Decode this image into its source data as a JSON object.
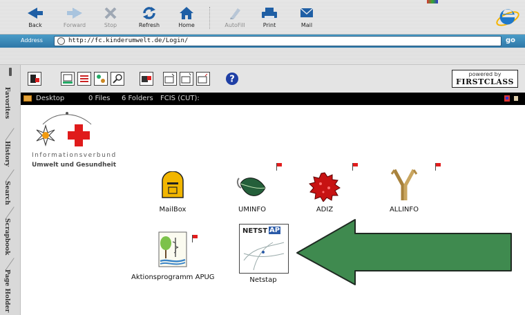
{
  "browser": {
    "toolbar": [
      {
        "label": "Back",
        "icon": "back-arrow-icon",
        "enabled": true
      },
      {
        "label": "Forward",
        "icon": "forward-arrow-icon",
        "enabled": false
      },
      {
        "label": "Stop",
        "icon": "stop-icon",
        "enabled": false
      },
      {
        "label": "Refresh",
        "icon": "refresh-icon",
        "enabled": true
      },
      {
        "label": "Home",
        "icon": "home-icon",
        "enabled": true
      },
      {
        "label": "AutoFill",
        "icon": "autofill-icon",
        "enabled": false
      },
      {
        "label": "Print",
        "icon": "print-icon",
        "enabled": true
      },
      {
        "label": "Mail",
        "icon": "mail-icon",
        "enabled": true
      }
    ],
    "address_label": "Address",
    "address_url": "http://fc.kinderumwelt.de/Login/",
    "go_label": "go"
  },
  "sidebar_tabs": [
    "Favorites",
    "History",
    "Search",
    "Scrapbook",
    "Page Holder"
  ],
  "firstclass": {
    "powered_by_small": "powered by",
    "powered_by_brand": "FIRSTCLASS",
    "desktop_bar": {
      "title": "Desktop",
      "files": "0 Files",
      "folders": "6 Folders",
      "clock": "FCIS (CUT):"
    }
  },
  "logo": {
    "line1": "Informationsverbund",
    "line2": "Umwelt und Gesundheit"
  },
  "desktop_items": [
    {
      "label": "MailBox",
      "icon": "mailbox-icon",
      "flag": false
    },
    {
      "label": "UMINFO",
      "icon": "uminfo-icon",
      "flag": true
    },
    {
      "label": "ADIZ",
      "icon": "adiz-icon",
      "flag": true
    },
    {
      "label": "ALLINFO",
      "icon": "allinfo-icon",
      "flag": true
    },
    {
      "label": "Aktionsprogramm APUG",
      "icon": "apug-icon",
      "flag": true
    },
    {
      "label": "Netstap",
      "icon": "netstap-icon",
      "flag": false,
      "logo_text_left": "NETST",
      "logo_text_right": "AP"
    }
  ],
  "colors": {
    "arrow": "#3f8a4f",
    "address_bar": "#3a86b8",
    "flag": "#e21d1d",
    "mailbox": "#f0b400"
  }
}
